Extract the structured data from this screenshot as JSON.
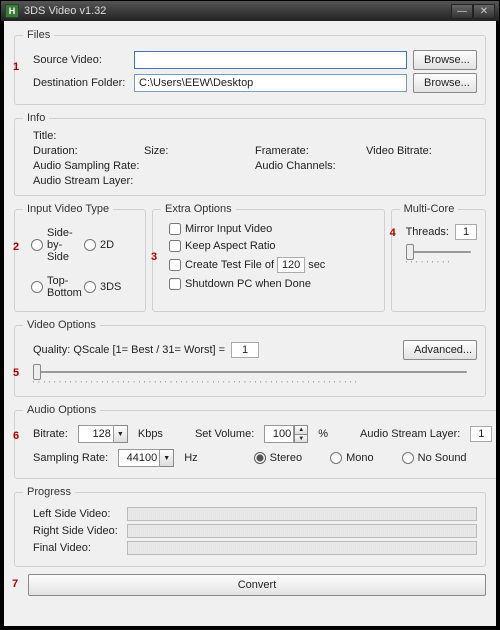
{
  "window": {
    "title": "3DS Video v1.32",
    "icon_letter": "H"
  },
  "markers": [
    "1",
    "2",
    "3",
    "4",
    "5",
    "6",
    "7"
  ],
  "files": {
    "legend": "Files",
    "source_label": "Source Video:",
    "source_value": "",
    "dest_label": "Destination Folder:",
    "dest_value": "C:\\Users\\EEW\\Desktop",
    "browse_label": "Browse..."
  },
  "info": {
    "legend": "Info",
    "title_label": "Title:",
    "duration_label": "Duration:",
    "size_label": "Size:",
    "framerate_label": "Framerate:",
    "bitrate_label": "Video Bitrate:",
    "asr_label": "Audio Sampling Rate:",
    "channels_label": "Audio Channels:",
    "asl_label": "Audio Stream Layer:"
  },
  "input_type": {
    "legend": "Input Video Type",
    "opts": {
      "sbs": "Side-by-Side",
      "two_d": "2D",
      "tb": "Top-Bottom",
      "tds": "3DS"
    }
  },
  "extras": {
    "legend": "Extra Options",
    "mirror": "Mirror Input Video",
    "aspect": "Keep Aspect Ratio",
    "test_prefix": "Create Test File of",
    "test_value": "120",
    "test_suffix": "sec",
    "shutdown": "Shutdown PC when Done"
  },
  "multicore": {
    "legend": "Multi-Core",
    "threads_label": "Threads:",
    "threads_value": "1"
  },
  "video": {
    "legend": "Video Options",
    "quality_label": "Quality:  QScale [1= Best / 31= Worst] =",
    "quality_value": "1",
    "advanced_label": "Advanced..."
  },
  "audio": {
    "legend": "Audio Options",
    "bitrate_label": "Bitrate:",
    "bitrate_value": "128",
    "bitrate_unit": "Kbps",
    "volume_label": "Set Volume:",
    "volume_value": "100",
    "volume_unit": "%",
    "asl_label": "Audio Stream Layer:",
    "asl_value": "1",
    "sampling_label": "Sampling Rate:",
    "sampling_value": "44100",
    "sampling_unit": "Hz",
    "mode": {
      "stereo": "Stereo",
      "mono": "Mono",
      "none": "No Sound"
    }
  },
  "progress": {
    "legend": "Progress",
    "left_label": "Left Side Video:",
    "right_label": "Right Side Video:",
    "final_label": "Final Video:"
  },
  "convert": {
    "label": "Convert"
  }
}
